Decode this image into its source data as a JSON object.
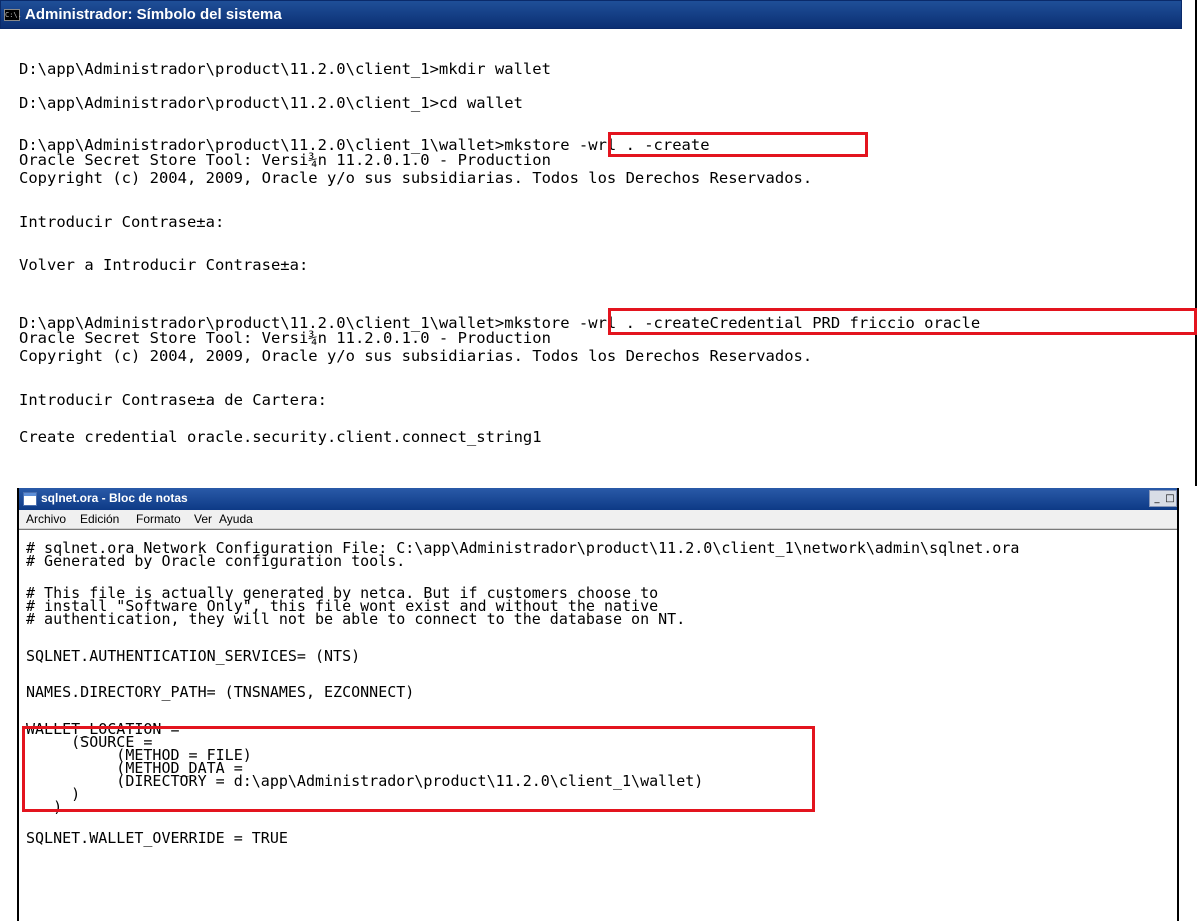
{
  "cmd": {
    "title": "Administrador: Símbolo del sistema",
    "icon_text": "C:\\.",
    "lines": [
      "D:\\app\\Administrador\\product\\11.2.0\\client_1>mkdir wallet",
      "D:\\app\\Administrador\\product\\11.2.0\\client_1>cd wallet",
      "D:\\app\\Administrador\\product\\11.2.0\\client_1\\wallet>mkstore -wrl . -create",
      "Oracle Secret Store Tool: Versi¾n 11.2.0.1.0 - Production",
      "Copyright (c) 2004, 2009, Oracle y/o sus subsidiarias. Todos los Derechos Reservados.",
      "Introducir Contrase±a:",
      "Volver a Introducir Contrase±a:",
      "D:\\app\\Administrador\\product\\11.2.0\\client_1\\wallet>mkstore -wrl . -createCredential PRD friccio oracle",
      "Oracle Secret Store Tool: Versi¾n 11.2.0.1.0 - Production",
      "Copyright (c) 2004, 2009, Oracle y/o sus subsidiarias. Todos los Derechos Reservados.",
      "Introducir Contrase±a de Cartera:",
      "Create credential oracle.security.client.connect_string1"
    ]
  },
  "notepad": {
    "title": "sqlnet.ora - Bloc de notas",
    "controls": {
      "minimize": "_",
      "maximize": "□"
    },
    "menu": [
      "Archivo",
      "Edición",
      "Formato",
      "Ver",
      "Ayuda"
    ],
    "lines": [
      "# sqlnet.ora Network Configuration File: C:\\app\\Administrador\\product\\11.2.0\\client_1\\network\\admin\\sqlnet.ora",
      "# Generated by Oracle configuration tools.",
      "# This file is actually generated by netca. But if customers choose to",
      "# install \"Software Only\", this file wont exist and without the native",
      "# authentication, they will not be able to connect to the database on NT.",
      "SQLNET.AUTHENTICATION_SERVICES= (NTS)",
      "NAMES.DIRECTORY_PATH= (TNSNAMES, EZCONNECT)",
      "WALLET_LOCATION =",
      "     (SOURCE =",
      "          (METHOD = FILE)",
      "          (METHOD_DATA =",
      "          (DIRECTORY = d:\\app\\Administrador\\product\\11.2.0\\client_1\\wallet)",
      "     )",
      "   )",
      "SQLNET.WALLET_OVERRIDE = TRUE"
    ]
  },
  "highlight_color": "#e3141e"
}
